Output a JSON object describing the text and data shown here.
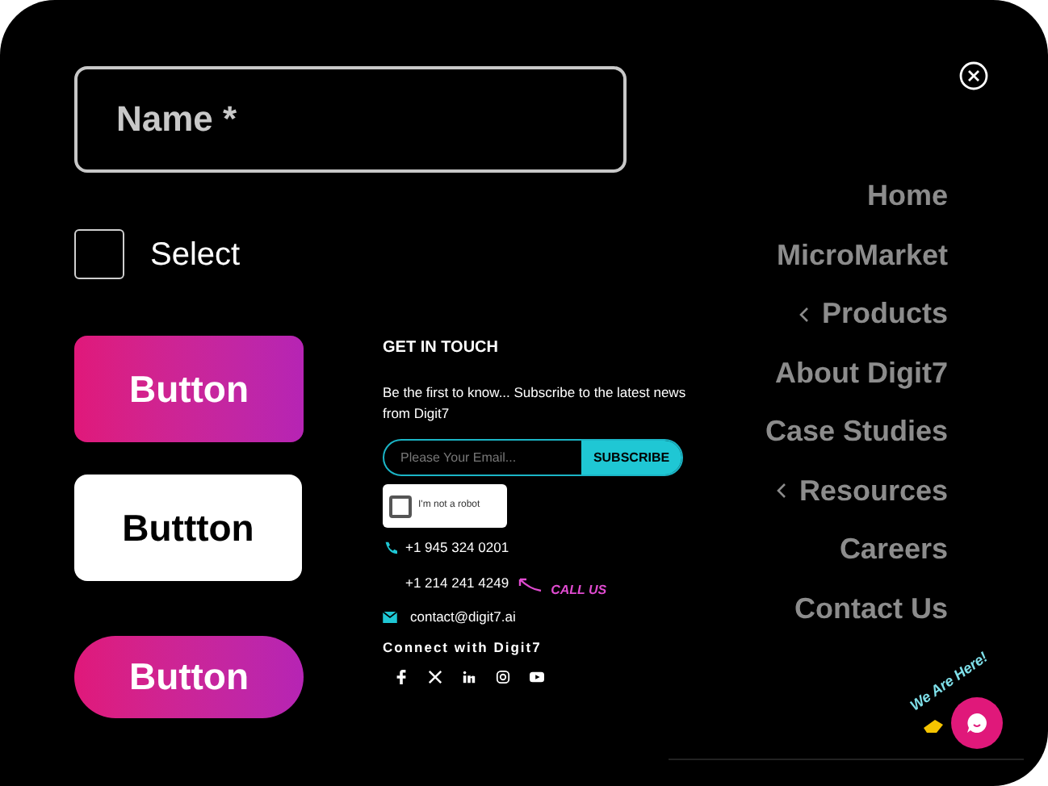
{
  "form": {
    "name_field": {
      "placeholder": "Name *"
    },
    "checkbox": {
      "label": "Select",
      "checked": false
    },
    "buttons": [
      {
        "label": "Button",
        "kind": "gradient"
      },
      {
        "label": "Buttton",
        "kind": "white"
      },
      {
        "label": "Button",
        "kind": "pill"
      }
    ]
  },
  "newsletter": {
    "heading": "GET IN TOUCH",
    "text": "Be the first to know... Subscribe to the latest news from Digit7",
    "email": {
      "placeholder": "Please Your Email..."
    },
    "subscribe_label": "SUBSCRIBE",
    "captcha": {
      "label": "I'm not a robot",
      "checked": false
    },
    "phones": [
      "+1 945 324 0201",
      "+1 214 241 4249"
    ],
    "call_note": "CALL US",
    "email_address": "contact@digit7.ai",
    "connect_heading": "Connect with Digit7"
  },
  "menu": {
    "items": [
      {
        "label": "Home",
        "submenu": false
      },
      {
        "label": "MicroMarket",
        "submenu": false
      },
      {
        "label": "Products",
        "submenu": true
      },
      {
        "label": "About Digit7",
        "submenu": false
      },
      {
        "label": "Case Studies",
        "submenu": false
      },
      {
        "label": "Resources",
        "submenu": true
      },
      {
        "label": "Careers",
        "submenu": false
      },
      {
        "label": "Contact Us",
        "submenu": false
      }
    ]
  },
  "chat": {
    "badge": "We Are Here!"
  }
}
